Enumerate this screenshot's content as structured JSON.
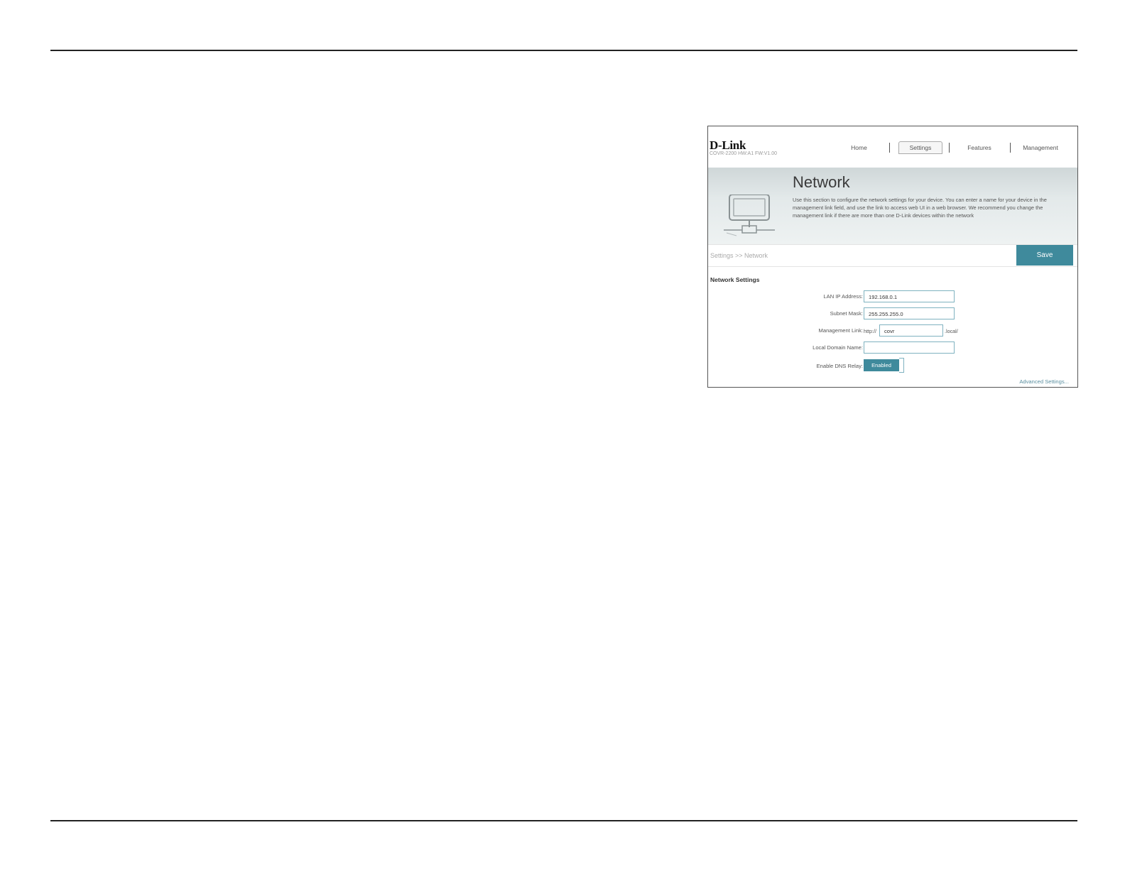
{
  "header": {
    "logo": "D-Link",
    "model": "COVR-2200 HW:A1 FW:V1.00",
    "nav": [
      "Home",
      "Settings",
      "Features",
      "Management"
    ]
  },
  "banner": {
    "title": "Network",
    "description": "Use this section to configure the network settings for your device. You can enter a name for your device in the management link field, and use the link to access web UI in a web browser. We recommend you change the management link if there are more than one D-Link devices within the network",
    "icon": "network-computer-icon"
  },
  "breadcrumb": "Settings >> Network",
  "save_label": "Save",
  "section_title": "Network Settings",
  "fields": {
    "lan_ip_label": "LAN IP Address:",
    "lan_ip_value": "192.168.0.1",
    "subnet_label": "Subnet Mask:",
    "subnet_value": "255.255.255.0",
    "mgmt_label": "Management Link:",
    "mgmt_prefix": "http://",
    "mgmt_value": "covr",
    "mgmt_suffix": ".local/",
    "domain_label": "Local Domain Name:",
    "domain_value": "",
    "dns_label": "Enable DNS Relay:",
    "dns_value": "Enabled"
  },
  "advanced_link": "Advanced Settings...",
  "colors": {
    "accent": "#3f8a9c",
    "field_border": "#7fb2c0"
  }
}
